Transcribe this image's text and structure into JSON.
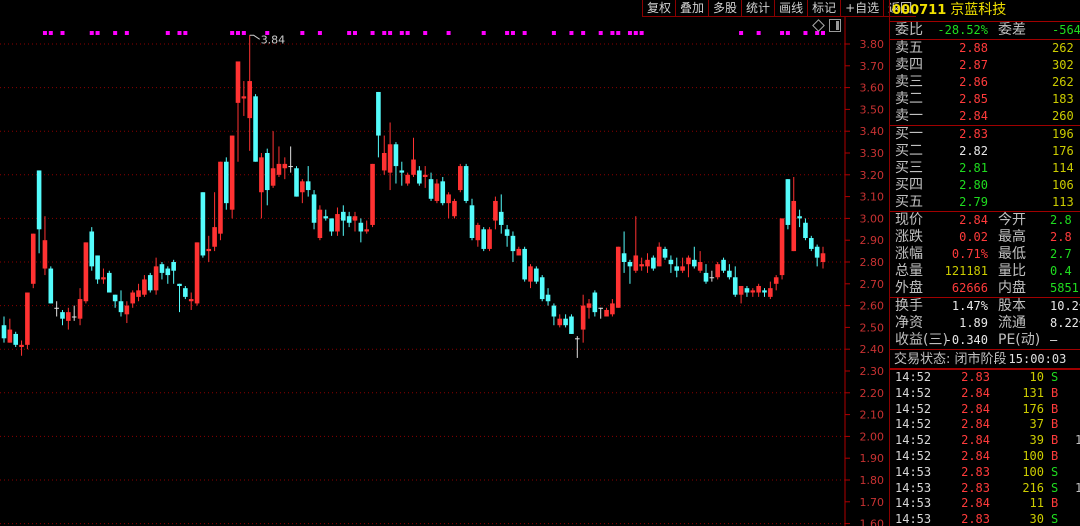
{
  "toolbar": {
    "buttons": [
      "复权",
      "叠加",
      "多股",
      "统计",
      "画线",
      "标记",
      "+自选",
      "返回"
    ]
  },
  "colors": {
    "up": "#ff3232",
    "down": "#54fcfc",
    "doji": "#e0e0e0",
    "grid": "#8b0000",
    "axis_label": "#c83232",
    "signal": "#ff00ff"
  },
  "chart_data": {
    "type": "candlestick",
    "ylim": [
      1.6,
      3.85
    ],
    "yticks": [
      "3.80",
      "3.70",
      "3.60",
      "3.50",
      "3.40",
      "3.30",
      "3.20",
      "3.10",
      "3.00",
      "2.90",
      "2.80",
      "2.70",
      "2.60",
      "2.50",
      "2.40",
      "2.30",
      "2.20",
      "2.10",
      "2.00",
      "1.90",
      "1.80",
      "1.70",
      "1.60"
    ],
    "grid": "dotted every 0.20",
    "high_annotation": "3.84",
    "high_index": 42,
    "signals": [
      7,
      8,
      10,
      15,
      16,
      19,
      21,
      28,
      30,
      31,
      39,
      40,
      41,
      45,
      51,
      54,
      59,
      60,
      63,
      65,
      66,
      68,
      69,
      72,
      76,
      82,
      86,
      87,
      89,
      94,
      97,
      99,
      102,
      104,
      105,
      107,
      108,
      109,
      126,
      129,
      133,
      134,
      137,
      139,
      140
    ],
    "candles_ochl_note": "each entry [open, close, high, low]",
    "candles": [
      [
        2.51,
        2.45,
        2.55,
        2.43
      ],
      [
        2.43,
        2.49,
        2.54,
        2.43
      ],
      [
        2.47,
        2.42,
        2.48,
        2.41
      ],
      [
        2.41,
        2.42,
        2.44,
        2.37
      ],
      [
        2.42,
        2.66,
        2.66,
        2.4
      ],
      [
        2.7,
        2.93,
        2.93,
        2.68
      ],
      [
        3.22,
        2.95,
        3.22,
        2.84
      ],
      [
        2.77,
        2.9,
        3.01,
        2.74
      ],
      [
        2.77,
        2.61,
        2.78,
        2.61
      ],
      [
        2.59,
        2.59,
        2.62,
        2.55
      ],
      [
        2.57,
        2.54,
        2.58,
        2.51
      ],
      [
        2.53,
        2.57,
        2.59,
        2.49
      ],
      [
        2.55,
        2.55,
        2.6,
        2.53
      ],
      [
        2.54,
        2.63,
        2.68,
        2.51
      ],
      [
        2.62,
        2.89,
        2.89,
        2.61
      ],
      [
        2.94,
        2.78,
        2.96,
        2.76
      ],
      [
        2.83,
        2.72,
        2.83,
        2.7
      ],
      [
        2.72,
        2.73,
        2.77,
        2.7
      ],
      [
        2.75,
        2.66,
        2.76,
        2.66
      ],
      [
        2.65,
        2.62,
        2.65,
        2.59
      ],
      [
        2.62,
        2.57,
        2.67,
        2.55
      ],
      [
        2.56,
        2.6,
        2.62,
        2.52
      ],
      [
        2.61,
        2.66,
        2.67,
        2.59
      ],
      [
        2.64,
        2.67,
        2.7,
        2.62
      ],
      [
        2.65,
        2.72,
        2.74,
        2.64
      ],
      [
        2.74,
        2.67,
        2.75,
        2.66
      ],
      [
        2.67,
        2.78,
        2.82,
        2.65
      ],
      [
        2.79,
        2.75,
        2.8,
        2.72
      ],
      [
        2.77,
        2.74,
        2.78,
        2.7
      ],
      [
        2.8,
        2.76,
        2.81,
        2.7
      ],
      [
        2.7,
        2.69,
        2.7,
        2.57
      ],
      [
        2.68,
        2.64,
        2.69,
        2.63
      ],
      [
        2.62,
        2.63,
        2.66,
        2.58
      ],
      [
        2.61,
        2.89,
        2.89,
        2.6
      ],
      [
        3.12,
        2.83,
        3.12,
        2.82
      ],
      [
        2.85,
        2.86,
        2.92,
        2.8
      ],
      [
        2.87,
        2.96,
        3.12,
        2.85
      ],
      [
        2.93,
        3.26,
        3.26,
        2.9
      ],
      [
        3.26,
        3.07,
        3.28,
        3.04
      ],
      [
        3.04,
        3.38,
        3.38,
        3.0
      ],
      [
        3.53,
        3.72,
        3.72,
        3.26
      ],
      [
        3.55,
        3.56,
        3.63,
        3.47
      ],
      [
        3.46,
        3.63,
        3.84,
        3.31
      ],
      [
        3.56,
        3.26,
        3.57,
        3.26
      ],
      [
        3.12,
        3.28,
        3.3,
        3.0
      ],
      [
        3.3,
        3.13,
        3.32,
        3.06
      ],
      [
        3.15,
        3.23,
        3.4,
        3.14
      ],
      [
        3.2,
        3.25,
        3.33,
        3.19
      ],
      [
        3.23,
        3.25,
        3.28,
        3.18
      ],
      [
        3.24,
        3.24,
        3.33,
        3.21
      ],
      [
        3.23,
        3.1,
        3.24,
        3.1
      ],
      [
        3.12,
        3.17,
        3.18,
        3.07
      ],
      [
        3.17,
        3.13,
        3.24,
        3.1
      ],
      [
        3.11,
        2.98,
        3.13,
        2.95
      ],
      [
        2.91,
        3.04,
        3.06,
        2.9
      ],
      [
        3.01,
        3.0,
        3.04,
        2.99
      ],
      [
        3.0,
        2.94,
        3.0,
        2.92
      ],
      [
        2.94,
        3.02,
        3.05,
        2.92
      ],
      [
        3.03,
        2.99,
        3.06,
        2.92
      ],
      [
        3.01,
        2.98,
        3.03,
        2.96
      ],
      [
        2.99,
        3.01,
        3.03,
        2.94
      ],
      [
        2.98,
        2.94,
        3.0,
        2.89
      ],
      [
        2.94,
        2.95,
        2.99,
        2.93
      ],
      [
        2.97,
        3.25,
        3.25,
        2.96
      ],
      [
        3.58,
        3.38,
        3.58,
        3.28
      ],
      [
        3.22,
        3.3,
        3.38,
        3.2
      ],
      [
        3.21,
        3.34,
        3.44,
        3.13
      ],
      [
        3.34,
        3.24,
        3.35,
        3.16
      ],
      [
        3.22,
        3.21,
        3.26,
        3.15
      ],
      [
        3.16,
        3.2,
        3.21,
        3.15
      ],
      [
        3.2,
        3.27,
        3.37,
        3.19
      ],
      [
        3.22,
        3.16,
        3.24,
        3.15
      ],
      [
        3.19,
        3.2,
        3.24,
        3.14
      ],
      [
        3.18,
        3.09,
        3.21,
        3.08
      ],
      [
        3.08,
        3.16,
        3.18,
        3.07
      ],
      [
        3.17,
        3.07,
        3.19,
        3.06
      ],
      [
        3.07,
        3.11,
        3.12,
        3.0
      ],
      [
        3.01,
        3.08,
        3.09,
        3.0
      ],
      [
        3.13,
        3.24,
        3.25,
        3.12
      ],
      [
        3.24,
        3.08,
        3.25,
        3.07
      ],
      [
        3.06,
        2.91,
        3.09,
        2.9
      ],
      [
        2.9,
        2.97,
        2.98,
        2.87
      ],
      [
        2.95,
        2.86,
        2.96,
        2.85
      ],
      [
        2.86,
        2.95,
        2.96,
        2.85
      ],
      [
        2.99,
        3.08,
        3.1,
        2.95
      ],
      [
        3.03,
        2.97,
        3.11,
        2.93
      ],
      [
        2.95,
        2.92,
        2.97,
        2.87
      ],
      [
        2.92,
        2.85,
        2.94,
        2.8
      ],
      [
        2.83,
        2.86,
        2.87,
        2.83
      ],
      [
        2.86,
        2.72,
        2.87,
        2.71
      ],
      [
        2.71,
        2.78,
        2.79,
        2.68
      ],
      [
        2.77,
        2.71,
        2.78,
        2.7
      ],
      [
        2.73,
        2.63,
        2.74,
        2.62
      ],
      [
        2.65,
        2.62,
        2.68,
        2.6
      ],
      [
        2.6,
        2.55,
        2.61,
        2.51
      ],
      [
        2.51,
        2.54,
        2.56,
        2.5
      ],
      [
        2.54,
        2.51,
        2.56,
        2.5
      ],
      [
        2.55,
        2.47,
        2.56,
        2.47
      ],
      [
        2.45,
        2.45,
        2.46,
        2.36
      ],
      [
        2.49,
        2.6,
        2.65,
        2.43
      ],
      [
        2.59,
        2.61,
        2.63,
        2.54
      ],
      [
        2.66,
        2.57,
        2.67,
        2.55
      ],
      [
        2.59,
        2.59,
        2.59,
        2.54
      ],
      [
        2.55,
        2.58,
        2.59,
        2.55
      ],
      [
        2.56,
        2.61,
        2.63,
        2.55
      ],
      [
        2.59,
        2.87,
        2.87,
        2.59
      ],
      [
        2.84,
        2.8,
        2.94,
        2.75
      ],
      [
        2.8,
        2.78,
        2.81,
        2.7
      ],
      [
        2.76,
        2.83,
        3.01,
        2.75
      ],
      [
        2.78,
        2.79,
        2.82,
        2.76
      ],
      [
        2.78,
        2.81,
        2.84,
        2.75
      ],
      [
        2.82,
        2.77,
        2.83,
        2.76
      ],
      [
        2.78,
        2.87,
        2.89,
        2.78
      ],
      [
        2.86,
        2.82,
        2.87,
        2.81
      ],
      [
        2.81,
        2.79,
        2.83,
        2.75
      ],
      [
        2.78,
        2.76,
        2.82,
        2.73
      ],
      [
        2.76,
        2.78,
        2.82,
        2.75
      ],
      [
        2.79,
        2.82,
        2.83,
        2.73
      ],
      [
        2.81,
        2.78,
        2.87,
        2.77
      ],
      [
        2.76,
        2.8,
        2.85,
        2.75
      ],
      [
        2.75,
        2.71,
        2.79,
        2.7
      ],
      [
        2.73,
        2.73,
        2.76,
        2.71
      ],
      [
        2.73,
        2.79,
        2.8,
        2.72
      ],
      [
        2.81,
        2.76,
        2.82,
        2.75
      ],
      [
        2.76,
        2.73,
        2.79,
        2.72
      ],
      [
        2.73,
        2.65,
        2.78,
        2.64
      ],
      [
        2.65,
        2.69,
        2.69,
        2.61
      ],
      [
        2.68,
        2.66,
        2.69,
        2.64
      ],
      [
        2.66,
        2.67,
        2.68,
        2.64
      ],
      [
        2.66,
        2.69,
        2.7,
        2.64
      ],
      [
        2.67,
        2.66,
        2.68,
        2.64
      ],
      [
        2.64,
        2.68,
        2.71,
        2.63
      ],
      [
        2.7,
        2.73,
        2.74,
        2.67
      ],
      [
        2.74,
        3.0,
        3.0,
        2.72
      ],
      [
        3.18,
        2.97,
        3.18,
        2.95
      ],
      [
        2.85,
        3.08,
        3.19,
        2.85
      ],
      [
        3.01,
        3.0,
        3.04,
        2.96
      ],
      [
        2.98,
        2.91,
        3.0,
        2.9
      ],
      [
        2.91,
        2.86,
        2.92,
        2.85
      ],
      [
        2.87,
        2.82,
        2.88,
        2.78
      ],
      [
        2.8,
        2.84,
        2.87,
        2.77
      ]
    ]
  },
  "quote": {
    "code": "000711",
    "name": "京蓝科技",
    "weibi_label": "委比",
    "weibi": "-28.52%",
    "weicha_label": "委差",
    "weicha": "-564",
    "sell": [
      {
        "label": "卖五",
        "price": "2.88",
        "vol": "262"
      },
      {
        "label": "卖四",
        "price": "2.87",
        "vol": "302"
      },
      {
        "label": "卖三",
        "price": "2.86",
        "vol": "262"
      },
      {
        "label": "卖二",
        "price": "2.85",
        "vol": "183"
      },
      {
        "label": "卖一",
        "price": "2.84",
        "vol": "260"
      }
    ],
    "buy": [
      {
        "label": "买一",
        "price": "2.83",
        "vol": "196"
      },
      {
        "label": "买二",
        "price": "2.82",
        "vol": "176"
      },
      {
        "label": "买三",
        "price": "2.81",
        "vol": "114"
      },
      {
        "label": "买四",
        "price": "2.80",
        "vol": "106"
      },
      {
        "label": "买五",
        "price": "2.79",
        "vol": "113"
      }
    ],
    "stats": [
      {
        "l1": "现价",
        "v1": "2.84",
        "c1": "red",
        "l2": "今开",
        "v2": "2.8",
        "c2": "grn"
      },
      {
        "l1": "涨跌",
        "v1": "0.02",
        "c1": "red",
        "l2": "最高",
        "v2": "2.8",
        "c2": "red"
      },
      {
        "l1": "涨幅",
        "v1": "0.71%",
        "c1": "red",
        "l2": "最低",
        "v2": "2.7",
        "c2": "grn"
      },
      {
        "l1": "总量",
        "v1": "121181",
        "c1": "yel",
        "l2": "量比",
        "v2": "0.4",
        "c2": "grn"
      },
      {
        "l1": "外盘",
        "v1": "62666",
        "c1": "red",
        "l2": "内盘",
        "v2": "5851",
        "c2": "grn"
      }
    ],
    "finance": [
      {
        "l1": "换手",
        "v1": "1.47%",
        "l2": "股本",
        "v2": "10.2亿"
      },
      {
        "l1": "净资",
        "v1": "1.89",
        "l2": "流通",
        "v2": "8.22亿"
      },
      {
        "l1": "收益(三)",
        "v1": "-0.340",
        "l2": "PE(动)",
        "v2": "—"
      }
    ],
    "state_label": "交易状态: 闭市阶段",
    "state_time": "15:00:03",
    "ticks": [
      {
        "time": "14:52",
        "price": "2.83",
        "vol": "10",
        "dir": "S",
        "extra": ""
      },
      {
        "time": "14:52",
        "price": "2.84",
        "vol": "131",
        "dir": "B",
        "extra": ""
      },
      {
        "time": "14:52",
        "price": "2.84",
        "vol": "176",
        "dir": "B",
        "extra": ""
      },
      {
        "time": "14:52",
        "price": "2.84",
        "vol": "37",
        "dir": "B",
        "extra": ""
      },
      {
        "time": "14:52",
        "price": "2.84",
        "vol": "39",
        "dir": "B",
        "extra": "1"
      },
      {
        "time": "14:52",
        "price": "2.84",
        "vol": "100",
        "dir": "B",
        "extra": ""
      },
      {
        "time": "14:53",
        "price": "2.83",
        "vol": "100",
        "dir": "S",
        "extra": ""
      },
      {
        "time": "14:53",
        "price": "2.83",
        "vol": "216",
        "dir": "S",
        "extra": "1"
      },
      {
        "time": "14:53",
        "price": "2.84",
        "vol": "11",
        "dir": "B",
        "extra": ""
      },
      {
        "time": "14:53",
        "price": "2.83",
        "vol": "30",
        "dir": "S",
        "extra": ""
      }
    ]
  }
}
